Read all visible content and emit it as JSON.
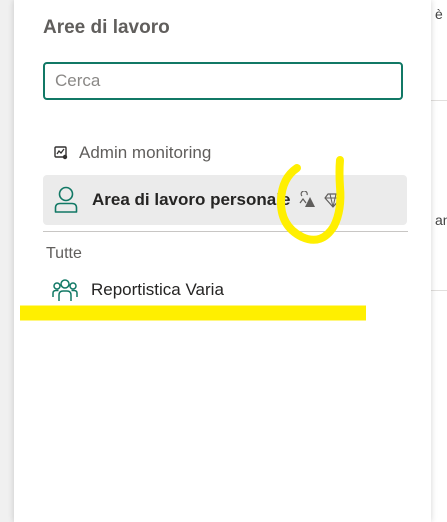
{
  "panel": {
    "title": "Aree di lavoro",
    "search": {
      "placeholder": "Cerca",
      "value": ""
    },
    "items": [
      {
        "label": "Admin monitoring",
        "icon": "monitor-chart-icon"
      },
      {
        "label": "Area di lavoro personale",
        "icon": "person-icon",
        "selected": true,
        "badges": [
          "premium-per-user-icon",
          "diamond-icon"
        ]
      }
    ],
    "section_label": "Tutte",
    "workspaces": [
      {
        "label": "Reportistica Varia",
        "icon": "group-icon"
      }
    ]
  },
  "right_edge_fragments": [
    "è",
    "an"
  ],
  "colors": {
    "accent": "#117865",
    "selected_bg": "#ebebeb",
    "annotation": "#ffef00"
  }
}
